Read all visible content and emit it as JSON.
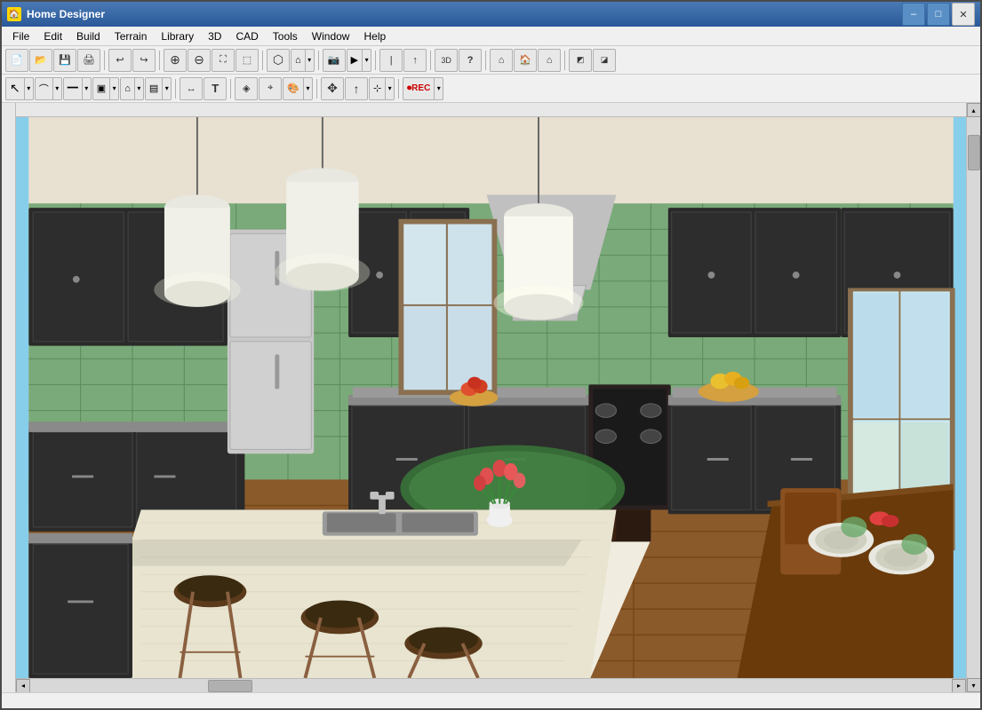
{
  "window": {
    "title": "Home Designer",
    "icon": "HD"
  },
  "titlebar": {
    "controls": {
      "minimize": "–",
      "maximize": "□",
      "close": "✕"
    }
  },
  "menubar": {
    "items": [
      {
        "label": "File",
        "id": "file"
      },
      {
        "label": "Edit",
        "id": "edit"
      },
      {
        "label": "Build",
        "id": "build"
      },
      {
        "label": "Terrain",
        "id": "terrain"
      },
      {
        "label": "Library",
        "id": "library"
      },
      {
        "label": "3D",
        "id": "3d"
      },
      {
        "label": "CAD",
        "id": "cad"
      },
      {
        "label": "Tools",
        "id": "tools"
      },
      {
        "label": "Window",
        "id": "window"
      },
      {
        "label": "Help",
        "id": "help"
      }
    ]
  },
  "toolbar1": {
    "buttons": [
      {
        "id": "new",
        "icon": "📄",
        "tooltip": "New"
      },
      {
        "id": "open",
        "icon": "📂",
        "tooltip": "Open"
      },
      {
        "id": "save",
        "icon": "💾",
        "tooltip": "Save"
      },
      {
        "id": "print",
        "icon": "🖨",
        "tooltip": "Print"
      },
      {
        "id": "undo",
        "icon": "↩",
        "tooltip": "Undo"
      },
      {
        "id": "redo",
        "icon": "↪",
        "tooltip": "Redo"
      },
      {
        "id": "zoom-in",
        "icon": "⊕",
        "tooltip": "Zoom In"
      },
      {
        "id": "zoom-out",
        "icon": "⊖",
        "tooltip": "Zoom Out"
      },
      {
        "id": "zoom-fit",
        "icon": "⛶",
        "tooltip": "Zoom to Fit"
      },
      {
        "id": "zoom-window",
        "icon": "⬚",
        "tooltip": "Zoom Window"
      },
      {
        "id": "3d-view",
        "icon": "⬡",
        "tooltip": "3D View"
      },
      {
        "id": "camera",
        "icon": "📷",
        "tooltip": "Camera"
      },
      {
        "id": "question",
        "icon": "?",
        "tooltip": "Help"
      },
      {
        "id": "house1",
        "icon": "⌂",
        "tooltip": "Floor Plan"
      },
      {
        "id": "house2",
        "icon": "⌂",
        "tooltip": "3D Overview"
      },
      {
        "id": "house3",
        "icon": "⌂",
        "tooltip": "Doll House"
      }
    ]
  },
  "toolbar2": {
    "buttons": [
      {
        "id": "select",
        "icon": "↖",
        "tooltip": "Select"
      },
      {
        "id": "arc",
        "icon": "⌒",
        "tooltip": "Arc"
      },
      {
        "id": "wall",
        "icon": "━",
        "tooltip": "Wall"
      },
      {
        "id": "cabinet",
        "icon": "▣",
        "tooltip": "Cabinet"
      },
      {
        "id": "fixture",
        "icon": "⌂",
        "tooltip": "Fixture"
      },
      {
        "id": "terrain",
        "icon": "▤",
        "tooltip": "Terrain"
      },
      {
        "id": "dimension",
        "icon": "↔",
        "tooltip": "Dimension"
      },
      {
        "id": "text",
        "icon": "T",
        "tooltip": "Text"
      },
      {
        "id": "material",
        "icon": "◈",
        "tooltip": "Material"
      },
      {
        "id": "eyedropper",
        "icon": "⌖",
        "tooltip": "Eyedropper"
      },
      {
        "id": "paint",
        "icon": "🖌",
        "tooltip": "Paint"
      },
      {
        "id": "move",
        "icon": "✥",
        "tooltip": "Move"
      },
      {
        "id": "arrow-up",
        "icon": "↑",
        "tooltip": "Arrow Up"
      },
      {
        "id": "transform",
        "icon": "⊹",
        "tooltip": "Transform"
      },
      {
        "id": "record",
        "icon": "⏺",
        "tooltip": "Record"
      }
    ]
  },
  "statusbar": {
    "text": ""
  },
  "scene": {
    "description": "3D kitchen interior with dark cabinets, green tile backsplash, hardwood floor, island with sink, pendant lights, dining table"
  }
}
